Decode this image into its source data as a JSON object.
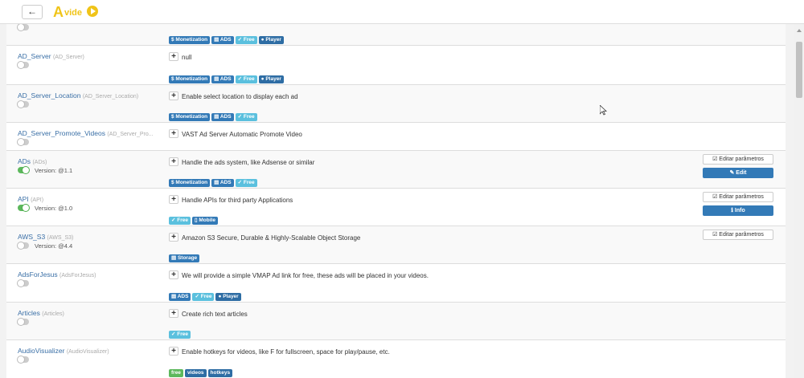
{
  "header": {
    "back_icon": "arrow-left-icon",
    "logo_text": "AVideo"
  },
  "colors": {
    "accent": "#337ab7",
    "light_tag": "#5bc0de",
    "green": "#5cb85c",
    "logo": "#f0c419"
  },
  "plugins": [
    {
      "name": "",
      "id": "",
      "enabled": false,
      "version": "",
      "description": "",
      "tags": [
        {
          "label": "Monetization",
          "icon": "$",
          "style": "blue"
        },
        {
          "label": "ADS",
          "icon": "▤",
          "style": "blue"
        },
        {
          "label": "Free",
          "icon": "✓",
          "style": "light"
        },
        {
          "label": "Player",
          "icon": "●",
          "style": "navy"
        }
      ],
      "buttons": []
    },
    {
      "name": "AD_Server",
      "id": "(AD_Server)",
      "enabled": false,
      "version": "",
      "description": "null",
      "tags": [
        {
          "label": "Monetization",
          "icon": "$",
          "style": "blue"
        },
        {
          "label": "ADS",
          "icon": "▤",
          "style": "blue"
        },
        {
          "label": "Free",
          "icon": "✓",
          "style": "light"
        },
        {
          "label": "Player",
          "icon": "●",
          "style": "navy"
        }
      ],
      "buttons": []
    },
    {
      "name": "AD_Server_Location",
      "id": "(AD_Server_Location)",
      "enabled": false,
      "version": "",
      "description": "Enable select location to display each ad",
      "tags": [
        {
          "label": "Monetization",
          "icon": "$",
          "style": "blue"
        },
        {
          "label": "ADS",
          "icon": "▤",
          "style": "blue"
        },
        {
          "label": "Free",
          "icon": "✓",
          "style": "light"
        }
      ],
      "buttons": []
    },
    {
      "name": "AD_Server_Promote_Videos",
      "id": "(AD_Server_Pro...",
      "enabled": false,
      "version": "",
      "description": "VAST Ad Server Automatic Promote Video",
      "tags": [],
      "buttons": []
    },
    {
      "name": "ADs",
      "id": "(ADs)",
      "enabled": true,
      "version": "Version: @1.1",
      "description": "Handle the ads system, like Adsense or similar",
      "tags": [
        {
          "label": "Monetization",
          "icon": "$",
          "style": "blue"
        },
        {
          "label": "ADS",
          "icon": "▤",
          "style": "blue"
        },
        {
          "label": "Free",
          "icon": "✓",
          "style": "light"
        }
      ],
      "buttons": [
        {
          "label": "Editar parâmetros",
          "icon": "☑",
          "kind": "edit-params"
        },
        {
          "label": "Edit",
          "icon": "✎",
          "kind": "primary"
        }
      ]
    },
    {
      "name": "API",
      "id": "(API)",
      "enabled": true,
      "version": "Version: @1.0",
      "description": "Handle APIs for third party Applications",
      "tags": [
        {
          "label": "Free",
          "icon": "✓",
          "style": "light"
        },
        {
          "label": "Mobile",
          "icon": "▯",
          "style": "blue"
        }
      ],
      "buttons": [
        {
          "label": "Editar parâmetros",
          "icon": "☑",
          "kind": "edit-params"
        },
        {
          "label": "Info",
          "icon": "ℹ",
          "kind": "primary"
        }
      ]
    },
    {
      "name": "AWS_S3",
      "id": "(AWS_S3)",
      "enabled": false,
      "version": "Version: @4.4",
      "description": "Amazon S3 Secure, Durable & Highly-Scalable Object Storage",
      "tags": [
        {
          "label": "Storage",
          "icon": "▤",
          "style": "blue"
        }
      ],
      "buttons": [
        {
          "label": "Editar parâmetros",
          "icon": "☑",
          "kind": "edit-params"
        }
      ]
    },
    {
      "name": "AdsForJesus",
      "id": "(AdsForJesus)",
      "enabled": false,
      "version": "",
      "description": "We will provide a simple VMAP Ad link for free, these ads will be placed in your videos.",
      "tags": [
        {
          "label": "ADS",
          "icon": "▤",
          "style": "blue"
        },
        {
          "label": "Free",
          "icon": "✓",
          "style": "light"
        },
        {
          "label": "Player",
          "icon": "●",
          "style": "navy"
        }
      ],
      "buttons": []
    },
    {
      "name": "Articles",
      "id": "(Articles)",
      "enabled": false,
      "version": "",
      "description": "Create rich text articles",
      "tags": [
        {
          "label": "Free",
          "icon": "✓",
          "style": "light"
        }
      ],
      "buttons": []
    },
    {
      "name": "AudioVisualizer",
      "id": "(AudioVisualizer)",
      "enabled": false,
      "version": "",
      "description": "Enable hotkeys for videos, like F for fullscreen, space for play/pause, etc.",
      "tags": [
        {
          "label": "free",
          "icon": "",
          "style": "green"
        },
        {
          "label": "videos",
          "icon": "",
          "style": "navy"
        },
        {
          "label": "hotkeys",
          "icon": "",
          "style": "navy"
        }
      ],
      "buttons": []
    }
  ]
}
